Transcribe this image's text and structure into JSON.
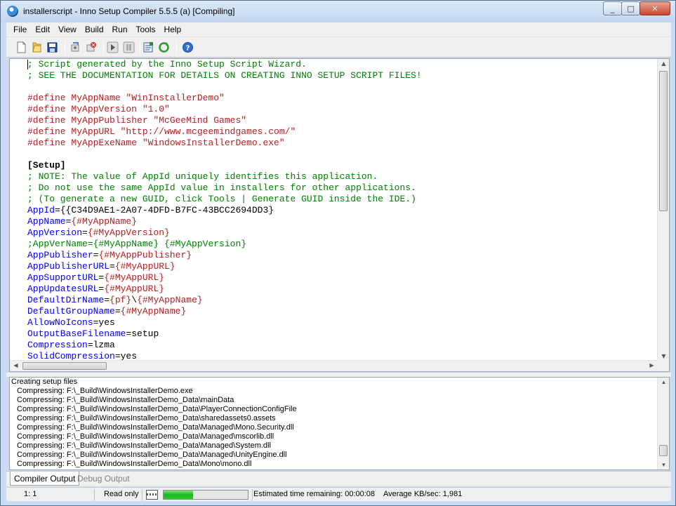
{
  "window": {
    "title": "installerscript - Inno Setup Compiler 5.5.5 (a)  [Compiling]",
    "controls": [
      "_",
      "□",
      "✕"
    ]
  },
  "menu": [
    "File",
    "Edit",
    "View",
    "Build",
    "Run",
    "Tools",
    "Help"
  ],
  "toolbar": {
    "buttons": [
      "new-file-icon",
      "open-folder-icon",
      "save-icon",
      "compile-icon",
      "stop-compile-icon",
      "run-icon",
      "pause-icon",
      "target-icon",
      "refresh-icon",
      "help-icon"
    ]
  },
  "editor": {
    "lines": [
      "; Script generated by the Inno Setup Script Wizard.",
      "; SEE THE DOCUMENTATION FOR DETAILS ON CREATING INNO SETUP SCRIPT FILES!",
      "",
      "#define MyAppName \"WinInstallerDemo\"",
      "#define MyAppVersion \"1.0\"",
      "#define MyAppPublisher \"McGeeMind Games\"",
      "#define MyAppURL \"http://www.mcgeemindgames.com/\"",
      "#define MyAppExeName \"WindowsInstallerDemo.exe\"",
      "",
      "[Setup]",
      "; NOTE: The value of AppId uniquely identifies this application.",
      "; Do not use the same AppId value in installers for other applications.",
      "; (To generate a new GUID, click Tools | Generate GUID inside the IDE.)",
      "AppId={{C34D9AE1-2A07-4DFD-B7FC-43BCC2694DD3}",
      "AppName={#MyAppName}",
      "AppVersion={#MyAppVersion}",
      ";AppVerName={#MyAppName} {#MyAppVersion}",
      "AppPublisher={#MyAppPublisher}",
      "AppPublisherURL={#MyAppURL}",
      "AppSupportURL={#MyAppURL}",
      "AppUpdatesURL={#MyAppURL}",
      "DefaultDirName={pf}\\{#MyAppName}",
      "DefaultGroupName={#MyAppName}",
      "AllowNoIcons=yes",
      "OutputBaseFilename=setup",
      "Compression=lzma",
      "SolidCompression=yes"
    ]
  },
  "output": {
    "lines": [
      "Creating setup files",
      "Compressing: F:\\_Build\\WindowsInstallerDemo.exe",
      "Compressing: F:\\_Build\\WindowsInstallerDemo_Data\\mainData",
      "Compressing: F:\\_Build\\WindowsInstallerDemo_Data\\PlayerConnectionConfigFile",
      "Compressing: F:\\_Build\\WindowsInstallerDemo_Data\\sharedassets0.assets",
      "Compressing: F:\\_Build\\WindowsInstallerDemo_Data\\Managed\\Mono.Security.dll",
      "Compressing: F:\\_Build\\WindowsInstallerDemo_Data\\Managed\\mscorlib.dll",
      "Compressing: F:\\_Build\\WindowsInstallerDemo_Data\\Managed\\System.dll",
      "Compressing: F:\\_Build\\WindowsInstallerDemo_Data\\Managed\\UnityEngine.dll",
      "Compressing: F:\\_Build\\WindowsInstallerDemo_Data\\Mono\\mono.dll"
    ]
  },
  "tabs": {
    "compiler_output": "Compiler Output",
    "debug_output": "Debug Output"
  },
  "status": {
    "position": "1:   1",
    "mode": "Read only",
    "progress": 0.35,
    "time_remaining": "Estimated time remaining: 00:00:08",
    "avg_speed": "Average KB/sec: 1,981"
  },
  "colors": {
    "comment": "#008000",
    "define": "#b22222",
    "key": "#0000ff",
    "progress": "#17b817"
  }
}
